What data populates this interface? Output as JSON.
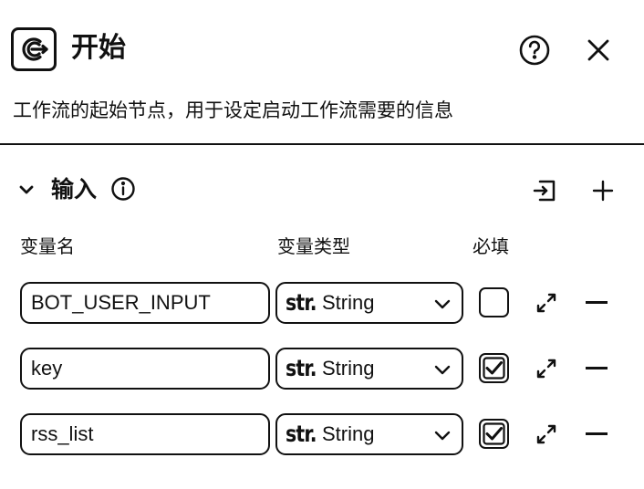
{
  "header": {
    "title": "开始",
    "description": "工作流的起始节点，用于设定启动工作流需要的信息"
  },
  "input_section": {
    "title": "输入",
    "columns": {
      "name": "变量名",
      "type": "变量类型",
      "required": "必填"
    },
    "rows": [
      {
        "name": "BOT_USER_INPUT",
        "type_prefix": "str.",
        "type": "String",
        "required": false
      },
      {
        "name": "key",
        "type_prefix": "str.",
        "type": "String",
        "required": true
      },
      {
        "name": "rss_list",
        "type_prefix": "str.",
        "type": "String",
        "required": true
      }
    ]
  },
  "icons": {
    "logo": "workflow-start-icon",
    "help": "help-icon",
    "close": "close-icon",
    "collapse": "chevron-down-icon",
    "info": "info-icon",
    "import": "import-icon",
    "add": "add-icon",
    "expand": "expand-icon",
    "remove": "minus-icon"
  },
  "colors": {
    "text": "#111111",
    "background": "#ffffff"
  }
}
